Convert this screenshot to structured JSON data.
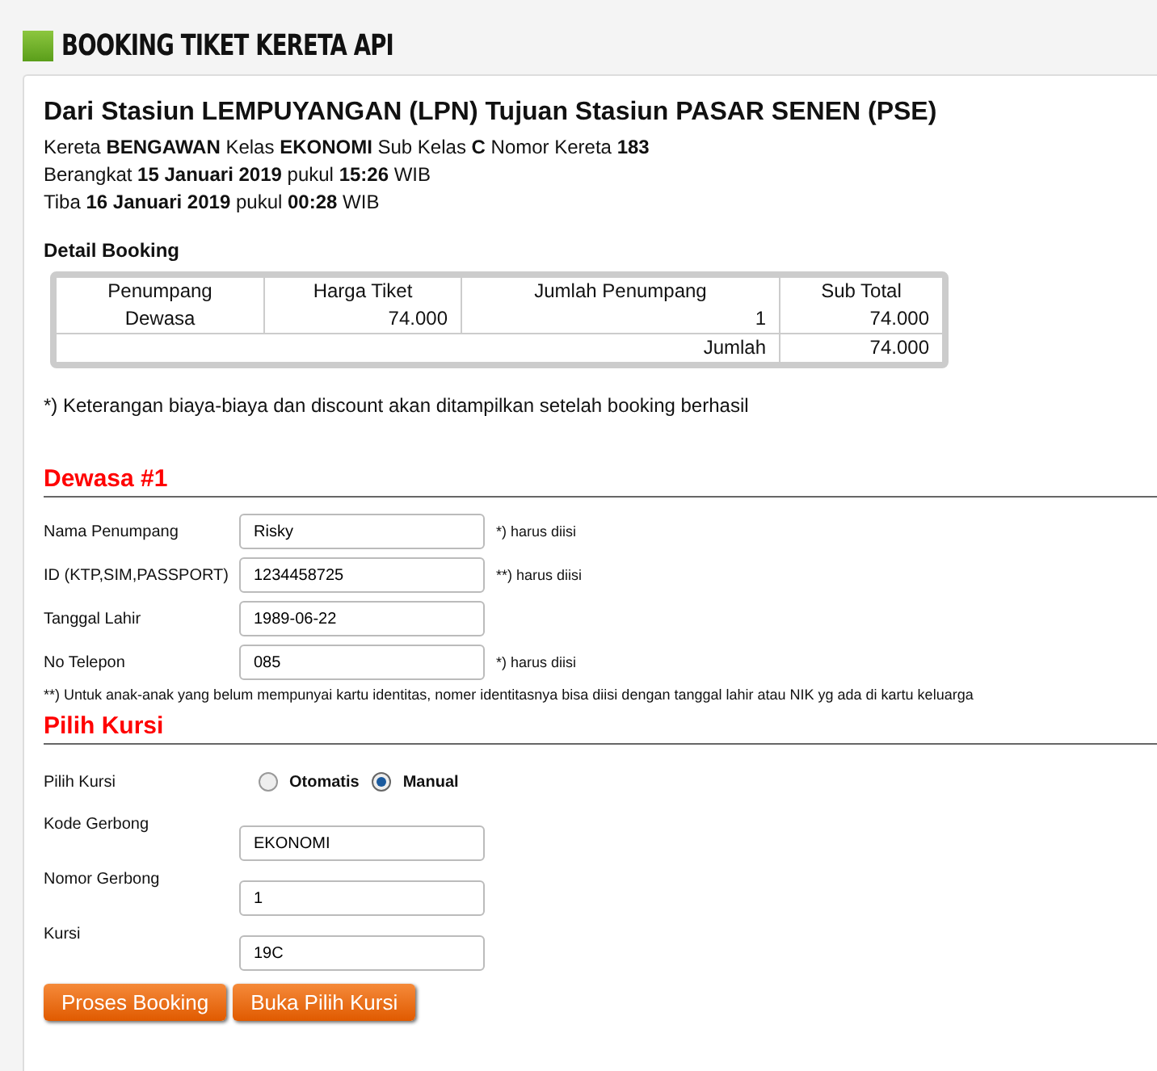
{
  "page_title": "BOOKING TIKET KERETA API",
  "route_title": "Dari Stasiun LEMPUYANGAN (LPN) Tujuan Stasiun PASAR SENEN (PSE)",
  "train_info": [
    "Kereta **BENGAWAN** Kelas **EKONOMI** Sub Kelas **C** Nomor Kereta **183**",
    "Berangkat **15 Januari 2019** pukul **15:26** WIB",
    "Tiba **16 Januari 2019** pukul **00:28** WIB"
  ],
  "detail_booking": {
    "heading": "Detail Booking",
    "columns": [
      "Penumpang",
      "Harga Tiket",
      "Jumlah Penumpang",
      "Sub Total"
    ],
    "rows": [
      [
        "Dewasa",
        "74.000",
        "1",
        "74.000"
      ]
    ],
    "total": {
      "label": "Jumlah",
      "value": "74.000"
    }
  },
  "note": "*) Keterangan biaya-biaya dan discount akan ditampilkan setelah booking berhasil",
  "passenger": {
    "heading": "Dewasa #1",
    "fields": [
      {
        "label": "Nama Penumpang",
        "value": "Risky",
        "hint": "*) harus diisi"
      },
      {
        "label": "ID (KTP,SIM,PASSPORT)",
        "value": "1234458725",
        "hint": "**) harus diisi"
      },
      {
        "label": "Tanggal Lahir",
        "value": "1989-06-22"
      },
      {
        "label": "No Telepon",
        "value": "085",
        "hint": "*) harus diisi"
      }
    ],
    "footnote": "**) Untuk anak-anak yang belum mempunyai kartu identitas, nomer identitasnya bisa diisi dengan tanggal lahir atau NIK yg ada di kartu keluarga"
  },
  "seat": {
    "heading": "Pilih Kursi",
    "label": "Pilih Kursi",
    "options": [
      {
        "label": "Otomatis",
        "selected": false
      },
      {
        "label": "Manual",
        "selected": true
      }
    ],
    "fields": [
      {
        "label": "Kode Gerbong",
        "value": "EKONOMI"
      },
      {
        "label": "Nomor Gerbong",
        "value": "1"
      },
      {
        "label": "Kursi",
        "value": "19C"
      }
    ]
  },
  "buttons": [
    "Proses Booking",
    "Buka Pilih Kursi"
  ]
}
